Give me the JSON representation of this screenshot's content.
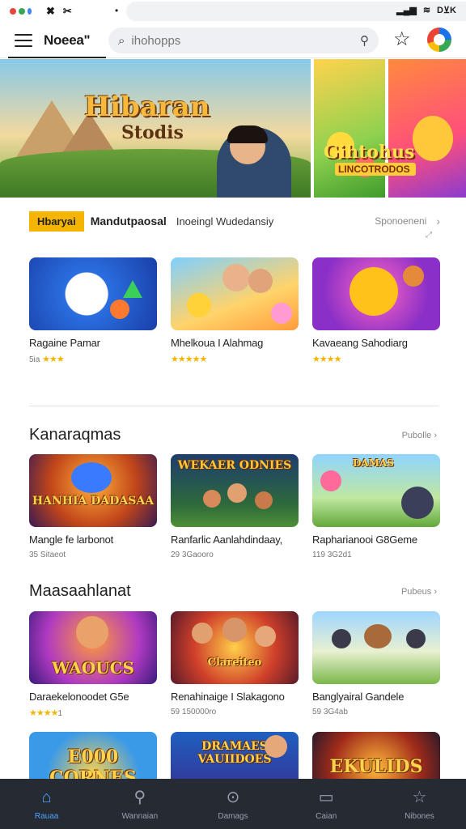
{
  "status_bar": {
    "left_icons": [
      "✖",
      "✂"
    ],
    "center_dot": "•",
    "right_text": "D⊻K",
    "colors": [
      "#e8453c",
      "#34a853",
      "#4285f4"
    ]
  },
  "header": {
    "title": "Noeea\"",
    "search_placeholder": "ihohopps"
  },
  "banner": {
    "main_title": "Hibaran",
    "main_subtitle": "Stodis",
    "side_title": "Gihtohus",
    "side_subtitle": "LINCOTRODOS"
  },
  "filters": {
    "tag": "Hbaryai",
    "item_a": "Mandutpaosal",
    "item_b": "Inoeingl Wudedansiy",
    "more": "Sponoeneni"
  },
  "featured": [
    {
      "title": "Ragaine Pamar",
      "meta": "5ia",
      "stars": "★★★",
      "thumb": "Blue ball game"
    },
    {
      "title": "Mhelkoua I Alahmag",
      "meta": "",
      "stars": "★★★★★",
      "thumb": "Adventure kids"
    },
    {
      "title": "Kavaeang Sahodiarg",
      "meta": "",
      "stars": "★★★★",
      "thumb": "Golden bear"
    }
  ],
  "section1": {
    "title": "Kanaraqmas",
    "more": "Pubolle",
    "items": [
      {
        "title": "Mangle fe larbonot",
        "meta": "35 Sitaeot",
        "label": "HANHIA DADASAA"
      },
      {
        "title": "Ranfarlic Aanlahdindaay,",
        "meta": "29 3Gaooro",
        "label": "WEKAER ODNIES"
      },
      {
        "title": "Rapharianooi G8Geme",
        "meta": "119 3G2d1",
        "label": "DAMAS"
      }
    ]
  },
  "section2": {
    "title": "Maasaahlanat",
    "more": "Pubeus",
    "items": [
      {
        "title": "Daraekelonoodet G5e",
        "meta": "",
        "stars": "★★★★",
        "meta_suffix": "1",
        "label": "WAOUCS"
      },
      {
        "title": "Renahinaige I Slakagono",
        "meta": "59 150000ro",
        "stars": "",
        "meta_suffix": "",
        "label": "Clareiteo"
      },
      {
        "title": "Banglyairal Gandele",
        "meta": "59 3G4ab",
        "stars": "",
        "meta_suffix": "",
        "label": ""
      }
    ]
  },
  "section3": {
    "items": [
      {
        "label": "E000 CORNES"
      },
      {
        "label": "DRAMAES VAUIIDOES"
      },
      {
        "label": "EKULIDS"
      }
    ]
  },
  "bottom_nav": [
    {
      "label": "Rauaa",
      "icon": "home-icon",
      "glyph": "⌂"
    },
    {
      "label": "Wannaian",
      "icon": "search-icon",
      "glyph": "⚲"
    },
    {
      "label": "Damags",
      "icon": "compass-icon",
      "glyph": "⊙"
    },
    {
      "label": "Caian",
      "icon": "folder-icon",
      "glyph": "▭"
    },
    {
      "label": "Nibones",
      "icon": "star-icon",
      "glyph": "☆"
    }
  ],
  "accent_colors": {
    "active_nav": "#4aa3ff",
    "tag": "#f4b400",
    "nav_bg": "#262a33"
  }
}
